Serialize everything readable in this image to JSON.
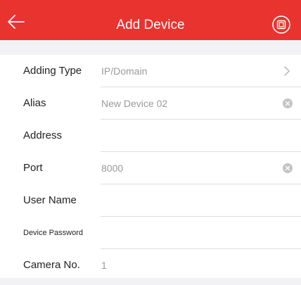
{
  "header": {
    "title": "Add Device",
    "back_icon": "arrow-left-icon",
    "action_icon": "qr-scan-icon",
    "bar_color": "#e8332f"
  },
  "form": {
    "rows": [
      {
        "label": "Adding Type",
        "value": "IP/Domain",
        "accessory": "chevron-right-icon"
      },
      {
        "label": "Alias",
        "value": "New Device 02",
        "accessory": "clear-icon"
      },
      {
        "label": "Address",
        "value": ""
      },
      {
        "label": "Port",
        "value": "8000",
        "accessory": "clear-icon"
      },
      {
        "label": "User Name",
        "value": ""
      },
      {
        "label": "Device Password",
        "value": ""
      },
      {
        "label": "Camera No.",
        "value": "1"
      }
    ]
  }
}
